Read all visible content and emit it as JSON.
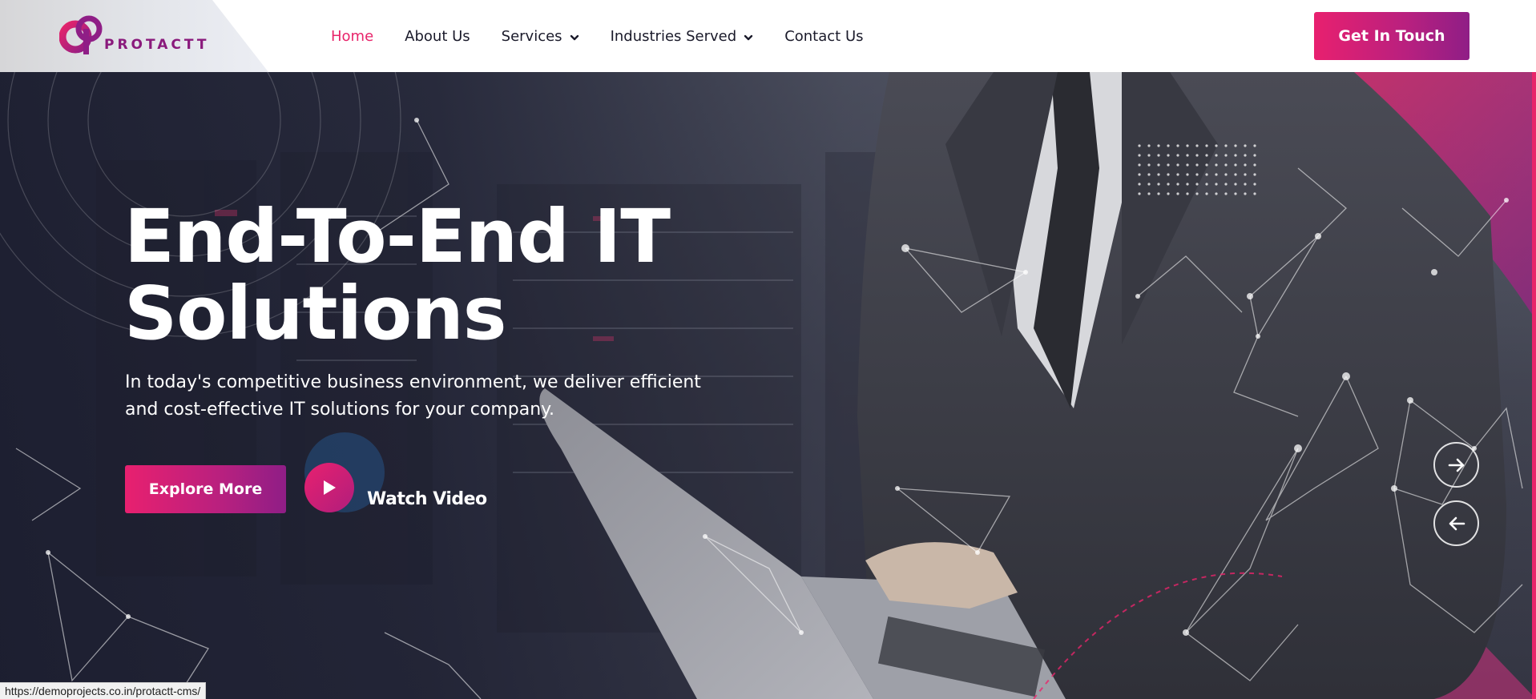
{
  "brand": {
    "name": "PROTACTT"
  },
  "nav": {
    "items": [
      {
        "label": "Home",
        "active": true,
        "has_dropdown": false
      },
      {
        "label": "About Us",
        "active": false,
        "has_dropdown": false
      },
      {
        "label": "Services",
        "active": false,
        "has_dropdown": true
      },
      {
        "label": "Industries Served",
        "active": false,
        "has_dropdown": true
      },
      {
        "label": "Contact Us",
        "active": false,
        "has_dropdown": false
      }
    ],
    "cta_label": "Get In Touch"
  },
  "hero": {
    "title_line1": "End-To-End IT",
    "title_line2": "Solutions",
    "subtitle_line1": "In today's competitive business environment, we deliver efficient",
    "subtitle_line2": "and cost-effective IT solutions for your company.",
    "explore_label": "Explore More",
    "watch_label": "Watch Video",
    "next_icon": "arrow-right-icon",
    "prev_icon": "arrow-left-icon"
  },
  "status_bar": {
    "url": "https://demoprojects.co.in/protactt-cms/"
  },
  "colors": {
    "accent": "#e8246a",
    "accent_purple": "#8f1e86",
    "nav_text": "#1a1a2a"
  }
}
